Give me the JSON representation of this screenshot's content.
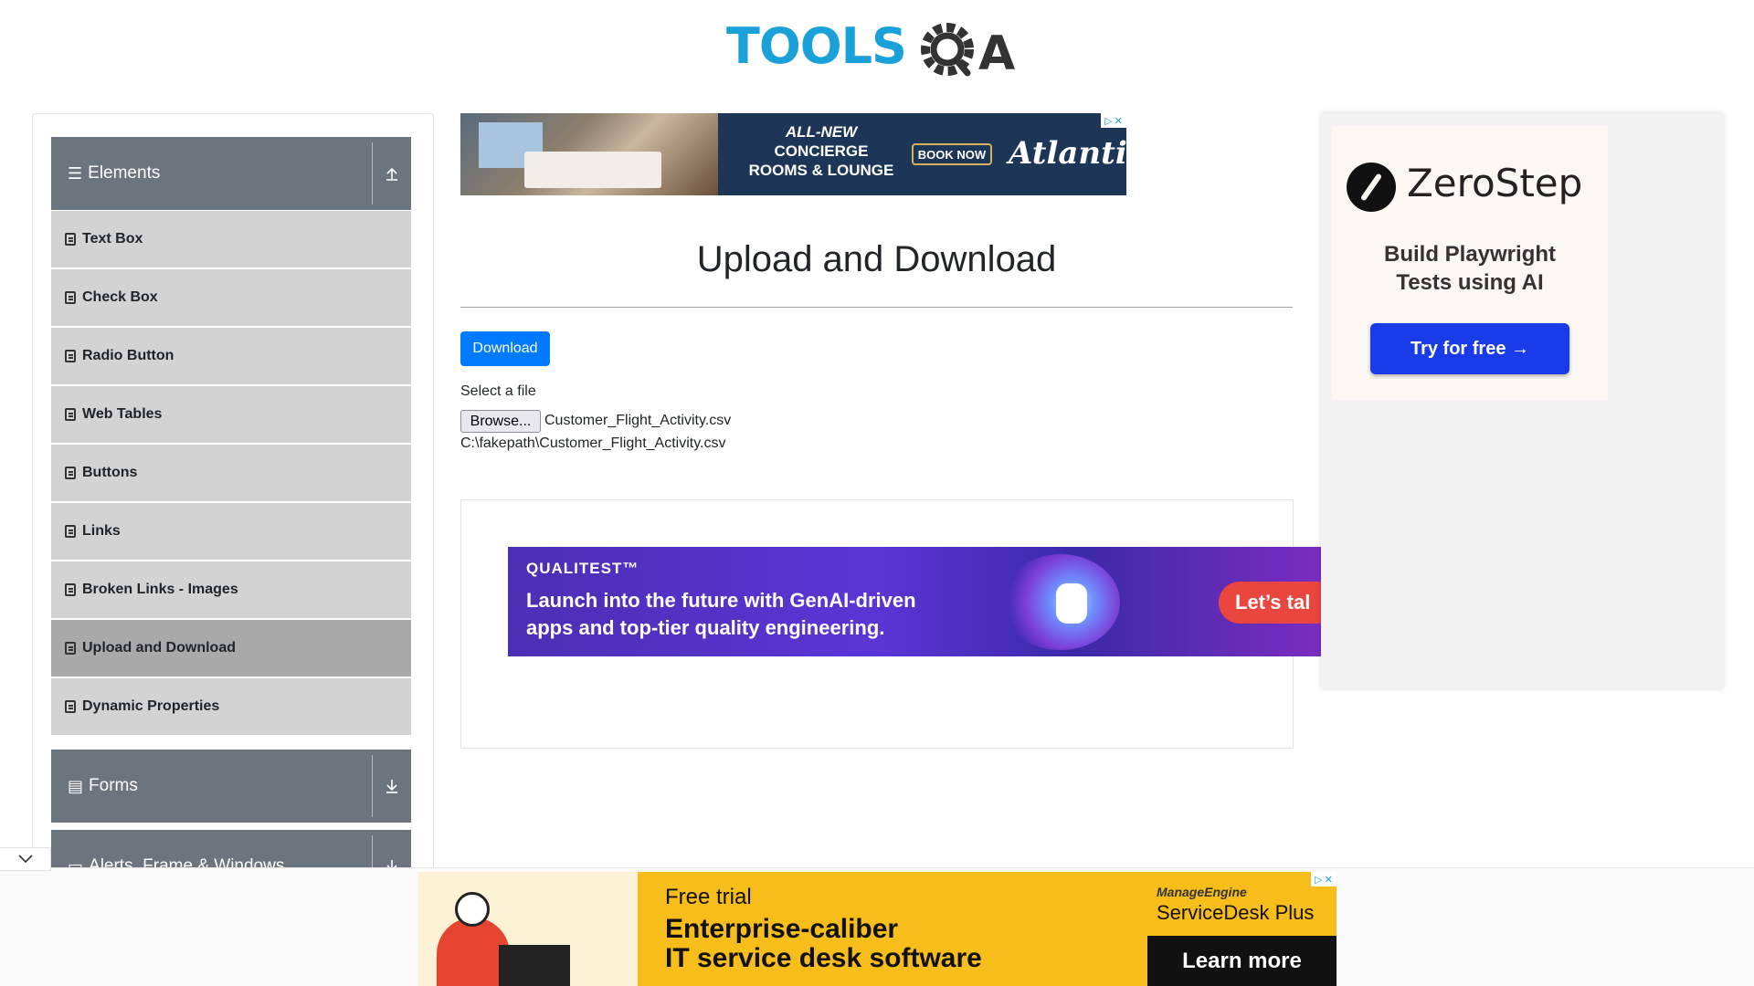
{
  "header": {
    "logo_text": "TOOLS",
    "logo_suffix": "A"
  },
  "sidebar": {
    "groups": [
      {
        "label": "Elements",
        "icon": "hamburger-icon",
        "toggle_icon": "arrow-up-icon"
      },
      {
        "label": "Forms",
        "icon": "document-icon",
        "toggle_icon": "arrow-down-icon"
      },
      {
        "label": "Alerts, Frame & Windows",
        "icon": "window-icon",
        "toggle_icon": "arrow-down-icon"
      }
    ],
    "items": [
      {
        "label": "Text Box"
      },
      {
        "label": "Check Box"
      },
      {
        "label": "Radio Button"
      },
      {
        "label": "Web Tables"
      },
      {
        "label": "Buttons"
      },
      {
        "label": "Links"
      },
      {
        "label": "Broken Links - Images"
      },
      {
        "label": "Upload and Download",
        "active": true
      },
      {
        "label": "Dynamic Properties"
      }
    ],
    "collapse_icon": "chevron-down-icon"
  },
  "main": {
    "title": "Upload and Download",
    "download_label": "Download",
    "select_label": "Select a file",
    "browse_label": "Browse...",
    "file_name": "Customer_Flight_Activity.csv",
    "uploaded_path": "C:\\fakepath\\Customer_Flight_Activity.csv",
    "accent_color": "#007bff"
  },
  "ads": {
    "top": {
      "line1": "ALL-NEW",
      "line2": "CONCIERGE",
      "line3": "ROOMS & LOUNGE",
      "cta": "BOOK NOW",
      "brand": "Atlantis"
    },
    "middle": {
      "brand": "QUALITEST™",
      "line1": "Launch into the future with GenAI-driven",
      "line2": "apps and top-tier quality engineering.",
      "cta": "Let’s tal"
    },
    "right": {
      "brand": "ZeroStep",
      "tagline1": "Build Playwright",
      "tagline2": "Tests using AI",
      "cta": "Try for free →"
    },
    "bottom": {
      "kicker": "Free trial",
      "line1": "Enterprise-caliber",
      "line2": "IT service desk software",
      "vendor": "ManageEngine",
      "product": "ServiceDesk Plus",
      "cta": "Learn more"
    }
  }
}
